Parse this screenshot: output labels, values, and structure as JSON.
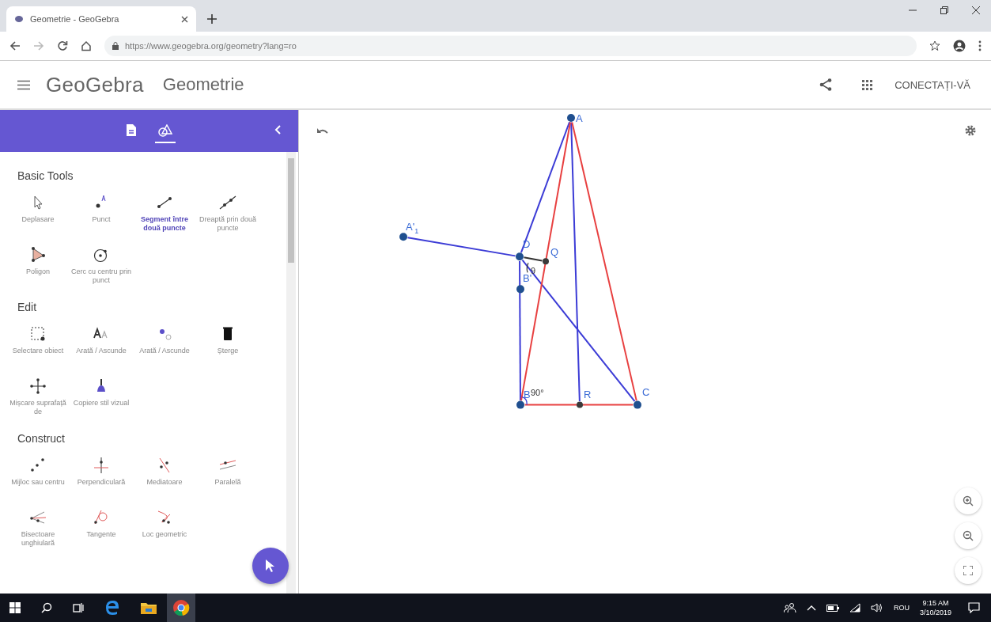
{
  "browser": {
    "tab": {
      "title": "Geometrie - GeoGebra"
    },
    "url": "https://www.geogebra.org/geometry?lang=ro"
  },
  "app": {
    "logo": "GeoGebra",
    "title": "Geometrie",
    "sign_in": "CONECTAȚI-VĂ"
  },
  "panel_tabs": [
    {
      "selected": false
    },
    {
      "selected": true
    }
  ],
  "tool_sections": [
    {
      "title": "Basic Tools",
      "tools": [
        {
          "label": "Deplasare",
          "selected": false
        },
        {
          "label": "Punct",
          "selected": false
        },
        {
          "label": "Segment între două puncte",
          "selected": true
        },
        {
          "label": "Dreaptă prin două puncte",
          "selected": false
        },
        {
          "label": "Poligon",
          "selected": false
        },
        {
          "label": "Cerc cu centru prin punct",
          "selected": false
        }
      ]
    },
    {
      "title": "Edit",
      "tools": [
        {
          "label": "Selectare obiect",
          "selected": false
        },
        {
          "label": "Arată / Ascunde",
          "selected": false
        },
        {
          "label": "Arată / Ascunde",
          "selected": false
        },
        {
          "label": "Șterge",
          "selected": false
        },
        {
          "label": "Mișcare suprafață de",
          "selected": false
        },
        {
          "label": "Copiere stil vizual",
          "selected": false
        }
      ]
    },
    {
      "title": "Construct",
      "tools": [
        {
          "label": "Mijloc sau centru",
          "selected": false
        },
        {
          "label": "Perpendiculară",
          "selected": false
        },
        {
          "label": "Mediatoare",
          "selected": false
        },
        {
          "label": "Paralelă",
          "selected": false
        },
        {
          "label": "Bisectoare unghiulară",
          "selected": false
        },
        {
          "label": "Tangente",
          "selected": false
        },
        {
          "label": "Loc geometric",
          "selected": false
        }
      ]
    }
  ],
  "canvas": {
    "labels": [
      "A",
      "A'$_{1}$",
      "D",
      "Q",
      "9",
      "B'",
      "B",
      "90°",
      "R",
      "C"
    ]
  },
  "taskbar": {
    "language": "ROU",
    "time": "9:15 AM",
    "date": "3/10/2019"
  }
}
